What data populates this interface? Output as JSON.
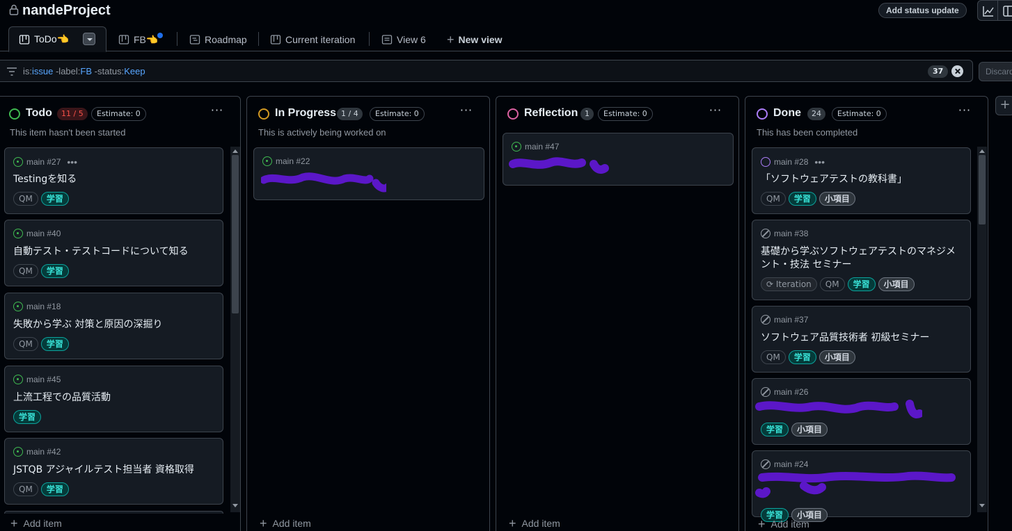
{
  "header": {
    "project_title": "nandeProject",
    "status_button": "Add status update"
  },
  "tabs": [
    {
      "label": "ToDo👈",
      "icon": "board-icon",
      "active": true
    },
    {
      "label": "FB👈",
      "icon": "board-icon",
      "has_dot": true
    },
    {
      "label": "Roadmap",
      "icon": "roadmap-icon"
    },
    {
      "label": "Current iteration",
      "icon": "board-icon"
    },
    {
      "label": "View 6",
      "icon": "table-icon"
    },
    {
      "label": "New view",
      "icon": "plus-icon"
    }
  ],
  "filter": {
    "parts": [
      {
        "k": "is:",
        "v": "issue"
      },
      {
        "k": " -label:",
        "v": "FB"
      },
      {
        "k": " -status:",
        "v": "Keep"
      }
    ],
    "count": "37",
    "discard_label": "Discard"
  },
  "columns": [
    {
      "name": "Todo",
      "count": "11 / 5",
      "estimate": "Estimate: 0",
      "description": "This item hasn't been started",
      "status_color": "#3fb950",
      "cards": [
        {
          "meta": "main #27",
          "title": "Testingを知る",
          "labels": [
            "QM",
            "学習"
          ],
          "show_dots": true
        },
        {
          "meta": "main #40",
          "title": "自動テスト・テストコードについて知る",
          "labels": [
            "QM",
            "学習"
          ]
        },
        {
          "meta": "main #18",
          "title": "失敗から学ぶ 対策と原因の深掘り",
          "labels": [
            "QM",
            "学習"
          ]
        },
        {
          "meta": "main #45",
          "title": "上流工程での品質活動",
          "labels": [
            "学習"
          ]
        },
        {
          "meta": "main #42",
          "title": "JSTQB アジャイルテスト担当者 資格取得",
          "labels": [
            "QM",
            "学習"
          ]
        }
      ],
      "add_item": "Add item"
    },
    {
      "name": "In Progress",
      "count": "1 / 4",
      "estimate": "Estimate: 0",
      "description": "This is actively being worked on",
      "status_color": "#d29922",
      "cards": [
        {
          "meta": "main #22",
          "title": "",
          "labels": []
        }
      ],
      "add_item": "Add item"
    },
    {
      "name": "Reflection",
      "count": "1",
      "estimate": "Estimate: 0",
      "description": "",
      "status_color": "#db61a2",
      "cards": [
        {
          "meta": "main #47",
          "title": "",
          "labels": []
        }
      ],
      "add_item": "Add item"
    },
    {
      "name": "Done",
      "count": "24",
      "estimate": "Estimate: 0",
      "description": "This has been completed",
      "status_color": "#ab7df8",
      "cards": [
        {
          "meta": "main #28",
          "title": "「ソフトウェアテストの教科書」",
          "labels": [
            "QM",
            "学習",
            "小項目"
          ],
          "show_dots": true
        },
        {
          "meta": "main #38",
          "title": "基礎から学ぶソフトウェアテストのマネジメント・技法 セミナー",
          "labels": [
            "Iteration",
            "QM",
            "学習",
            "小項目"
          ]
        },
        {
          "meta": "main #37",
          "title": "ソフトウェア品質技術者 初級セミナー",
          "labels": [
            "QM",
            "学習",
            "小項目"
          ]
        },
        {
          "meta": "main #26",
          "title": "",
          "labels": [
            "学習",
            "小項目"
          ]
        },
        {
          "meta": "main #24",
          "title": "",
          "labels": [
            "学習",
            "小項目"
          ]
        }
      ],
      "add_item": "Add item"
    }
  ],
  "colors": {
    "background": "#010409",
    "card": "#151b23",
    "border": "#3d444d",
    "study_label": "#38e0d5",
    "redaction": "#5b17c8"
  }
}
